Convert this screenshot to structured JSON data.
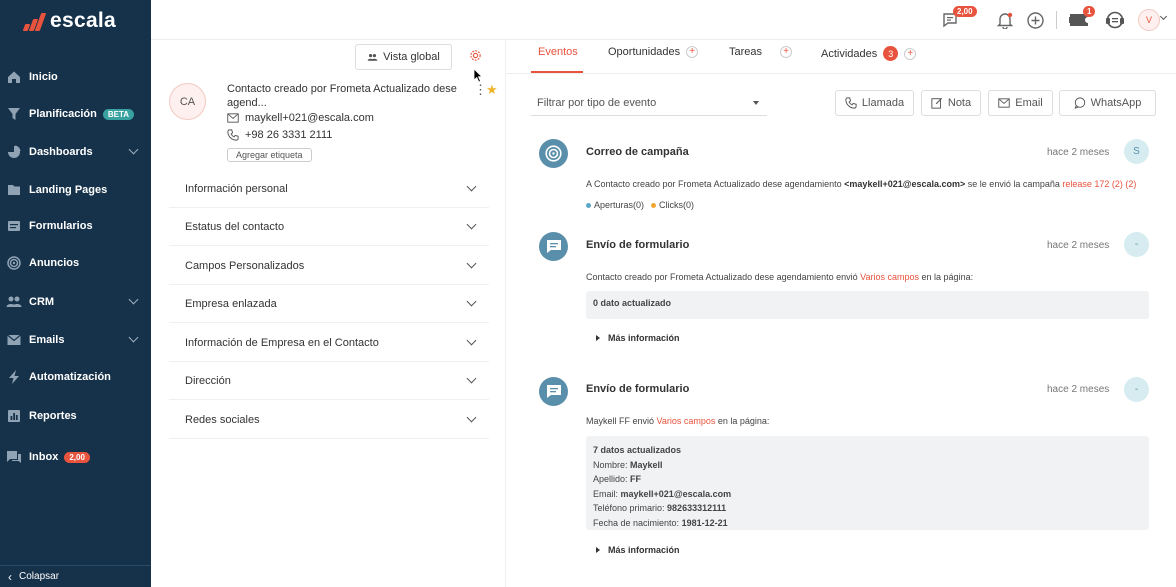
{
  "brand": {
    "name": "escala",
    "accent": "#e8533d",
    "sidebar_bg": "#16324a"
  },
  "sidebar": {
    "items": [
      {
        "label": "Inicio",
        "icon": "home-icon",
        "chevron": false
      },
      {
        "label": "Planificación",
        "icon": "funnel-icon",
        "badge": "BETA",
        "chevron": false
      },
      {
        "label": "Dashboards",
        "icon": "pie-chart-icon",
        "chevron": true
      },
      {
        "label": "Landing Pages",
        "icon": "folder-icon",
        "chevron": false
      },
      {
        "label": "Formularios",
        "icon": "form-icon",
        "chevron": false
      },
      {
        "label": "Anuncios",
        "icon": "target-icon",
        "chevron": false
      },
      {
        "label": "CRM",
        "icon": "users-icon",
        "chevron": true
      },
      {
        "label": "Emails",
        "icon": "mail-icon",
        "chevron": true
      },
      {
        "label": "Automatización",
        "icon": "lightning-icon",
        "chevron": false
      },
      {
        "label": "Reportes",
        "icon": "chart-icon",
        "chevron": false
      },
      {
        "label": "Inbox",
        "icon": "inbox-icon",
        "badge": "2,00",
        "chevron": false
      }
    ],
    "collapse_label": "Colapsar"
  },
  "topbar": {
    "chat_badge": "2,00",
    "notify_badge": "1",
    "user_initial": "V"
  },
  "contact": {
    "vista_global": "Vista global",
    "initials": "CA",
    "name": "Contacto creado por Frometa Actualizado dese agend...",
    "email": "maykell+021@escala.com",
    "phone": "+98 26 3331 2111",
    "tag_button": "Agregar etiqueta",
    "sections": [
      "Información personal",
      "Estatus del contacto",
      "Campos Personalizados",
      "Empresa enlazada",
      "Información de Empresa en el Contacto",
      "Dirección",
      "Redes sociales"
    ]
  },
  "tabs": {
    "eventos": "Eventos",
    "oportunidades": "Oportunidades",
    "tareas": "Tareas",
    "actividades": "Actividades",
    "actividades_count": "3",
    "plus": "+"
  },
  "filter": {
    "placeholder": "Filtrar por tipo de evento"
  },
  "actions": {
    "llamada": "Llamada",
    "nota": "Nota",
    "email": "Email",
    "whatsapp": "WhatsApp"
  },
  "events": {
    "e1": {
      "title": "Correo de campaña",
      "time": "hace 2 meses",
      "avatar": "S",
      "text_pre": "A Contacto creado por Frometa Actualizado dese agendamiento ",
      "text_email": "<maykell+021@escala.com>",
      "text_mid": " se le envió la campaña ",
      "text_link": "release 172 (2) (2)",
      "aperturas": "Aperturas(0)",
      "clicks": "Clicks(0)"
    },
    "e2": {
      "title": "Envío de formulario",
      "time": "hace 2 meses",
      "avatar": "-",
      "text_pre": "Contacto creado por Frometa Actualizado dese agendamiento envió ",
      "text_link": "Varios campos",
      "text_post": " en la página:",
      "box_title": "0 dato actualizado",
      "more": "Más información"
    },
    "e3": {
      "title": "Envío de formulario",
      "time": "hace 2 meses",
      "avatar": "-",
      "text_pre": "Maykell FF envió ",
      "text_link": "Varios campos",
      "text_post": " en la página:",
      "box_title": "7 datos actualizados",
      "fields": [
        {
          "label": "Nombre: ",
          "value": "Maykell"
        },
        {
          "label": "Apellido: ",
          "value": "FF"
        },
        {
          "label": "Email: ",
          "value": "maykell+021@escala.com"
        },
        {
          "label": "Teléfono primario: ",
          "value": "982633312111"
        },
        {
          "label": "Fecha de nacimiento: ",
          "value": "1981-12-21"
        }
      ],
      "more": "Más información"
    }
  }
}
